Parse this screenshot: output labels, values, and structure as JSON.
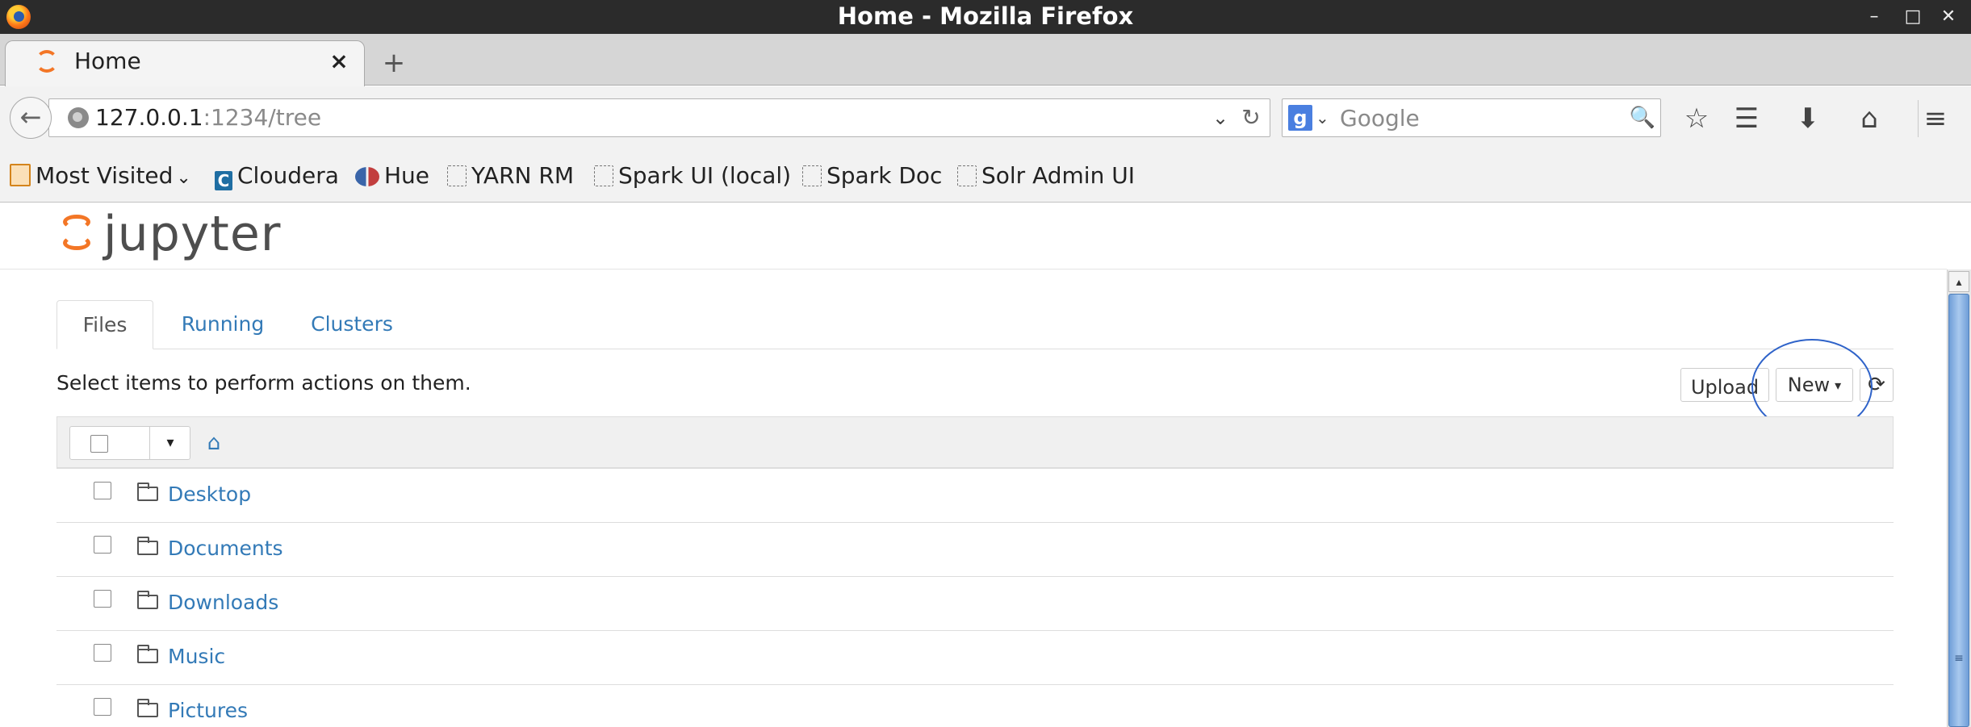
{
  "window": {
    "title": "Home - Mozilla Firefox",
    "controls": {
      "minimize": "–",
      "maximize": "□",
      "close": "✕"
    }
  },
  "browser": {
    "tab": {
      "title": "Home",
      "close_glyph": "×"
    },
    "new_tab_glyph": "+",
    "url": {
      "host": "127.0.0.1",
      "rest": ":1234/tree"
    },
    "search": {
      "engine_label": "g",
      "placeholder": "Google"
    },
    "toolbar_glyphs": {
      "back": "←",
      "dropdown": "⌄",
      "reload": "↻",
      "search_go": "🔍",
      "bookmark_star": "☆",
      "reading_list": "☰",
      "download": "⬇",
      "home": "⌂",
      "menu": "≡"
    },
    "bookmarks": [
      {
        "label": "Most Visited",
        "icon": "folder-icon",
        "caret": "⌄"
      },
      {
        "label": "Cloudera",
        "icon": "cloudera-icon"
      },
      {
        "label": "Hue",
        "icon": "hue-icon"
      },
      {
        "label": "YARN RM",
        "icon": "page-icon"
      },
      {
        "label": "Spark UI (local)",
        "icon": "page-icon"
      },
      {
        "label": "Spark Doc",
        "icon": "page-icon"
      },
      {
        "label": "Solr Admin UI",
        "icon": "page-icon"
      }
    ]
  },
  "jupyter": {
    "brand": "jupyter",
    "tabs": [
      {
        "label": "Files",
        "active": true
      },
      {
        "label": "Running",
        "active": false
      },
      {
        "label": "Clusters",
        "active": false
      }
    ],
    "hint": "Select items to perform actions on them.",
    "buttons": {
      "upload": "Upload",
      "new": "New",
      "new_caret": "▾",
      "refresh": "⟳"
    },
    "list_header": {
      "caret": "▾",
      "home_glyph": "⌂"
    },
    "items": [
      {
        "name": "Desktop",
        "type": "folder"
      },
      {
        "name": "Documents",
        "type": "folder"
      },
      {
        "name": "Downloads",
        "type": "folder"
      },
      {
        "name": "Music",
        "type": "folder"
      },
      {
        "name": "Pictures",
        "type": "folder"
      }
    ]
  },
  "scrollbar": {
    "up": "▴",
    "grip": "≡"
  },
  "colors": {
    "link": "#337ab7",
    "accent": "#f37626",
    "highlight": "#2f63c9"
  }
}
